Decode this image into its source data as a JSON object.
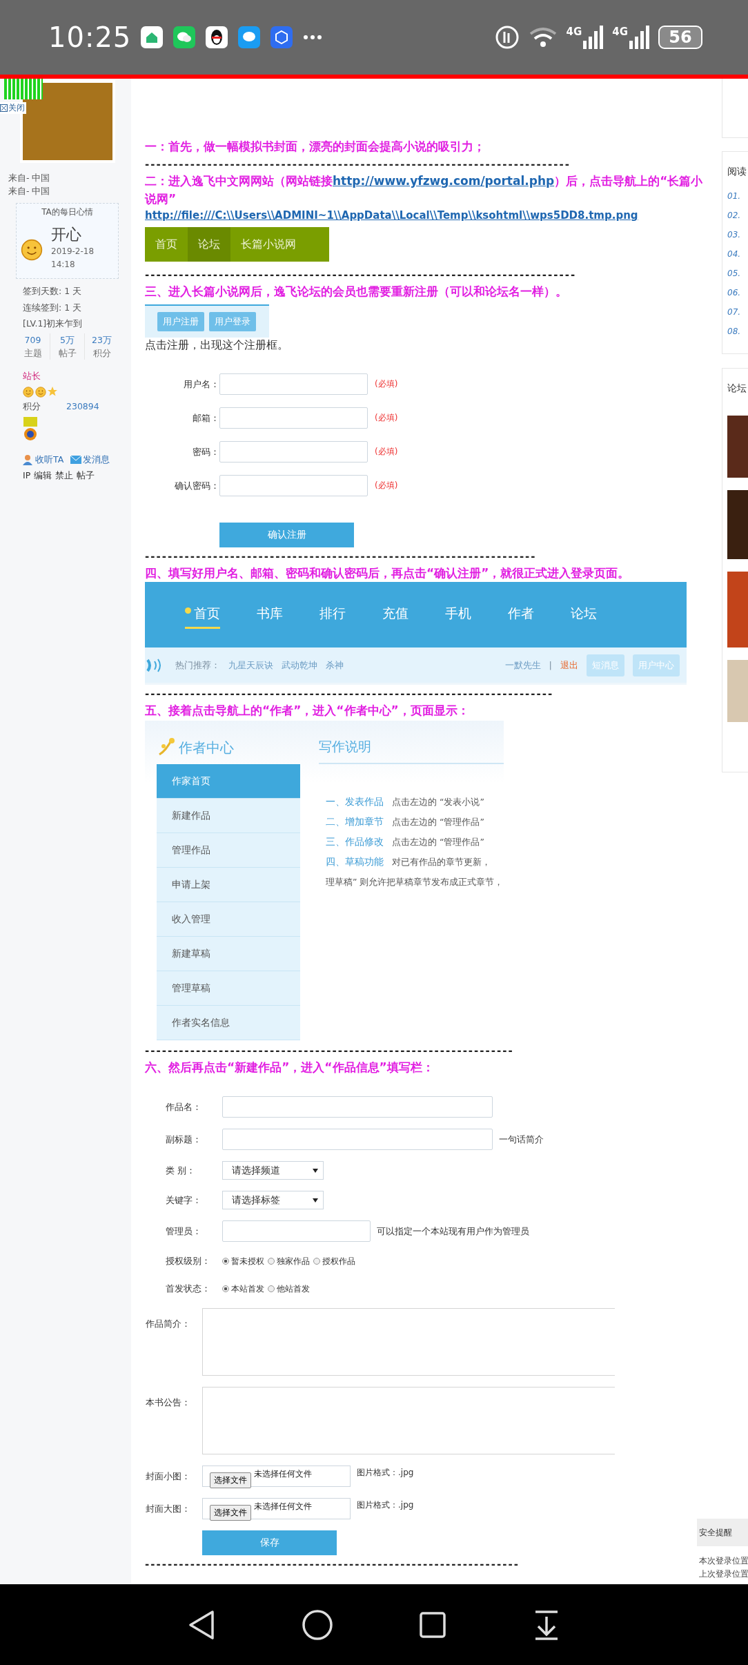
{
  "status_bar": {
    "time": "10:25",
    "network_labels": [
      "4G",
      "4G"
    ],
    "battery": "56"
  },
  "profile": {
    "close_label": "关闭",
    "from_lines": [
      "来自- 中国",
      "来自- 中国"
    ],
    "mood": {
      "title": "TA的每日心情",
      "mood": "开心",
      "time": "2019-2-18 14:18"
    },
    "checkin": [
      "签到天数: 1 天",
      "连续签到: 1 天",
      "[LV.1]初来乍到"
    ],
    "stats": [
      {
        "value": "709",
        "label": "主题"
      },
      {
        "value": "5万",
        "label": "帖子"
      },
      {
        "value": "23万",
        "label": "积分"
      }
    ],
    "rank": "站长",
    "points_label": "积分",
    "points_value": "230894",
    "actions": [
      {
        "kind": "follow",
        "label": "收听TA"
      },
      {
        "kind": "message",
        "label": "发消息"
      }
    ],
    "admin_links": [
      "IP",
      "编辑",
      "禁止",
      "帖子"
    ]
  },
  "article": [
    {
      "kind": "heading",
      "text": "一：首先，做一幅模拟书封面，漂亮的封面会提高小说的吸引力；"
    },
    {
      "kind": "dashes",
      "text": "---------------------------------------------------------------------------"
    },
    {
      "kind": "heading_link",
      "before": "二：进入逸飞中文网网站（网站链接",
      "link": "http://www.yfzwg.com/portal.php",
      "after": "）后，点击导航上的“长篇小说网”"
    },
    {
      "kind": "link",
      "text": "http://file:///C:\\\\Users\\\\ADMINI~1\\\\AppData\\\\Local\\\\Temp\\\\ksohtml\\\\wps5DD8.tmp.png"
    },
    {
      "kind": "green_nav",
      "items": [
        {
          "label": "首页",
          "selected": false
        },
        {
          "label": "论坛",
          "selected": true
        },
        {
          "label": "长篇小说网",
          "selected": false
        }
      ]
    },
    {
      "kind": "dashes",
      "text": "----------------------------------------------------------------------------"
    },
    {
      "kind": "heading",
      "text": "三、进入长篇小说网后，逸飞论坛的会员也需要重新注册（可以和论坛名一样）。"
    },
    {
      "kind": "tab_strip",
      "items": [
        "用户注册",
        "用户登录"
      ]
    },
    {
      "kind": "text",
      "text": "点击注册，出现这个注册框。"
    },
    {
      "kind": "register_form",
      "fields": [
        {
          "label": "用户名：",
          "note": "(必填)"
        },
        {
          "label": "邮箱：",
          "note": "(必填)"
        },
        {
          "label": "密码：",
          "note": "(必填)"
        },
        {
          "label": "确认密码：",
          "note": "(必填)"
        }
      ],
      "button": "确认注册"
    },
    {
      "kind": "dashes",
      "text": "---------------------------------------------------------------------"
    },
    {
      "kind": "heading",
      "text": "四、填写好用户名、邮箱、密码和确认密码后，再点击“确认注册”，就很正式进入登录页面。"
    },
    {
      "kind": "blue_nav",
      "items": [
        {
          "label": "首页",
          "selected": true
        },
        {
          "label": "书库",
          "selected": false
        },
        {
          "label": "排行",
          "selected": false
        },
        {
          "label": "充值",
          "selected": false
        },
        {
          "label": "手机",
          "selected": false
        },
        {
          "label": "作者",
          "selected": false
        },
        {
          "label": "论坛",
          "selected": false
        }
      ],
      "hot_label": "热门推荐：",
      "hot_items": [
        "九星天辰诀",
        "武动乾坤",
        "杀神"
      ],
      "user": "一默先生",
      "separator": "|",
      "logout": "退出",
      "buttons": [
        "短消息",
        "用户中心"
      ]
    },
    {
      "kind": "dashes",
      "text": "------------------------------------------------------------------------"
    },
    {
      "kind": "heading",
      "text": "五、接着点击导航上的“作者”，进入“作者中心”，页面显示："
    },
    {
      "kind": "author_center",
      "title": "作者中心",
      "menu": [
        {
          "label": "作家首页",
          "selected": true
        },
        {
          "label": "新建作品",
          "selected": false
        },
        {
          "label": "管理作品",
          "selected": false
        },
        {
          "label": "申请上架",
          "selected": false
        },
        {
          "label": "收入管理",
          "selected": false
        },
        {
          "label": "新建草稿",
          "selected": false
        },
        {
          "label": "管理草稿",
          "selected": false
        },
        {
          "label": "作者实名信息",
          "selected": false
        }
      ],
      "panel_title": "写作说明",
      "steps": [
        {
          "title": "一、发表作品",
          "desc": "点击左边的 “发表小说”"
        },
        {
          "title": "二、增加章节",
          "desc": "点击左边的 “管理作品”"
        },
        {
          "title": "三、作品修改",
          "desc": "点击左边的 “管理作品”"
        },
        {
          "title": "四、草稿功能",
          "desc": "对已有作品的章节更新，"
        }
      ],
      "note": "理草稿” 则允许把草稿章节发布成正式章节，"
    },
    {
      "kind": "dashes",
      "text": "-----------------------------------------------------------------"
    },
    {
      "kind": "heading",
      "text": "六、然后再点击“新建作品”，进入“作品信息”填写栏："
    },
    {
      "kind": "work_form",
      "rows": [
        {
          "kind": "input",
          "label": "作品名："
        },
        {
          "kind": "input",
          "label": "副标题：",
          "hint": "一句话简介"
        },
        {
          "kind": "select",
          "label": "类 别：",
          "value": "请选择频道"
        },
        {
          "kind": "select",
          "label": "关键字：",
          "value": "请选择标签"
        },
        {
          "kind": "short_input",
          "label": "管理员：",
          "hint": "可以指定一个本站现有用户作为管理员"
        },
        {
          "kind": "radio",
          "label": "授权级别：",
          "options": [
            {
              "label": "暂未授权",
              "selected": true
            },
            {
              "label": "独家作品",
              "selected": false
            },
            {
              "label": "授权作品",
              "selected": false
            }
          ]
        },
        {
          "kind": "radio",
          "label": "首发状态：",
          "options": [
            {
              "label": "本站首发",
              "selected": true
            },
            {
              "label": "他站首发",
              "selected": false
            }
          ]
        },
        {
          "kind": "textarea",
          "label": "作品简介："
        },
        {
          "kind": "textarea",
          "label": "本书公告："
        },
        {
          "kind": "file",
          "label": "封面小图：",
          "button": "选择文件",
          "status": "未选择任何文件",
          "hint": "图片格式：.jpg"
        },
        {
          "kind": "file",
          "label": "封面大图：",
          "button": "选择文件",
          "status": "未选择任何文件",
          "hint": "图片格式：.jpg"
        }
      ],
      "save": "保存"
    },
    {
      "kind": "dashes",
      "text": "------------------------------------------------------------------"
    }
  ],
  "right_column": {
    "reading_title": "阅读",
    "reading_items": [
      "01.",
      "02.",
      "03.",
      "04.",
      "05.",
      "06.",
      "07.",
      "08."
    ],
    "forum_title": "论坛",
    "security_title": "安全提醒",
    "login_lines": [
      "本次登录位置",
      "上次登录位置"
    ]
  }
}
